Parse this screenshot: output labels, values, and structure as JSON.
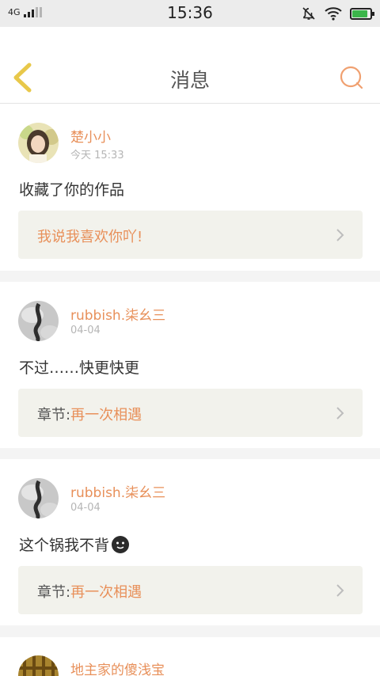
{
  "status_bar": {
    "network": "4G",
    "time": "15:36",
    "battery_level": 0.85
  },
  "header": {
    "title": "消息"
  },
  "messages": [
    {
      "username": "楚小小",
      "time": "今天 15:33",
      "content": "收藏了你的作品",
      "ref_label": "",
      "ref_title": "我说我喜欢你吖!"
    },
    {
      "username": "rubbish.柒幺三",
      "time": "04-04",
      "content": "不过……快更快更",
      "ref_label": "章节:",
      "ref_title": "再一次相遇"
    },
    {
      "username": "rubbish.柒幺三",
      "time": "04-04",
      "content": "这个锅我不背",
      "emoji_icon": "face-emoji-icon",
      "ref_label": "章节:",
      "ref_title": "再一次相遇"
    },
    {
      "username": "地主家的傻浅宝"
    }
  ],
  "colors": {
    "accent": "#e8905a",
    "back_icon": "#e8c84a",
    "ref_bg": "#f2f2ec",
    "battery": "#3bb54a"
  }
}
